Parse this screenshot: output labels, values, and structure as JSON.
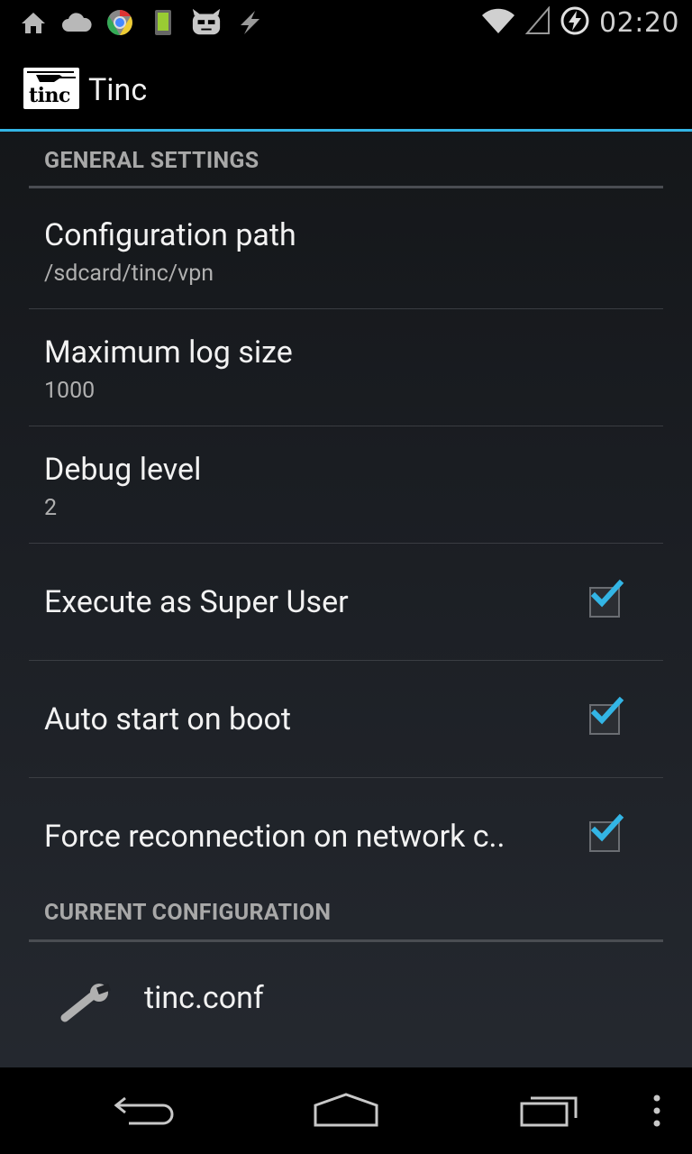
{
  "status_bar": {
    "time": "02:20",
    "left_icons": [
      "home-icon",
      "cloud-icon",
      "chrome-icon",
      "battery-phone-icon",
      "cyanogen-icon",
      "lightning-icon"
    ],
    "right_icons": [
      "wifi-icon",
      "signal-icon",
      "charging-icon"
    ]
  },
  "action_bar": {
    "logo_text": "tinc",
    "title": "Tinc"
  },
  "general": {
    "header": "GENERAL SETTINGS",
    "config_path": {
      "title": "Configuration path",
      "summary": "/sdcard/tinc/vpn"
    },
    "max_log": {
      "title": "Maximum log size",
      "summary": "1000"
    },
    "debug": {
      "title": "Debug level",
      "summary": "2"
    },
    "super_user": {
      "title": "Execute as Super User",
      "checked": true
    },
    "auto_start": {
      "title": "Auto start on boot",
      "checked": true
    },
    "force_reconnect": {
      "title": "Force reconnection on network c..",
      "checked": true
    }
  },
  "current": {
    "header": "CURRENT CONFIGURATION",
    "file": {
      "label": "tinc.conf",
      "icon": "wrench-icon"
    }
  },
  "nav_bar": {
    "buttons": [
      "back-icon",
      "home-icon",
      "recents-icon",
      "menu-icon"
    ]
  },
  "colors": {
    "accent": "#33b5e5",
    "background": "#1a1d22"
  }
}
